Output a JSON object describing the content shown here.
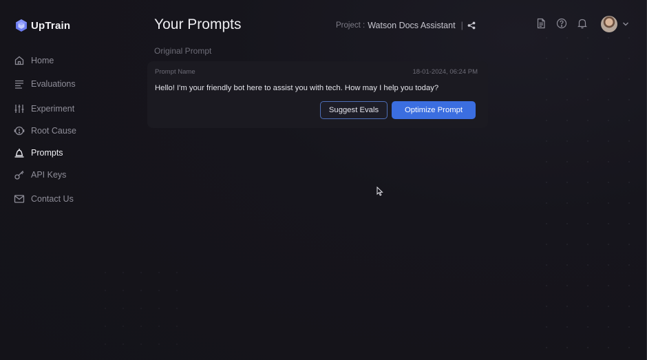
{
  "brand": {
    "name": "UpTrain",
    "accent": "#3b6ee0"
  },
  "sidebar": {
    "items": [
      {
        "label": "Home",
        "icon": "home-icon",
        "active": false
      },
      {
        "label": "Evaluations",
        "icon": "list-icon",
        "active": false
      },
      {
        "label": "Experiment",
        "icon": "sliders-icon",
        "active": false
      },
      {
        "label": "Root Cause",
        "icon": "alert-circle-icon",
        "active": false
      },
      {
        "label": "Prompts",
        "icon": "bell-prompt-icon",
        "active": true
      },
      {
        "label": "API Keys",
        "icon": "key-icon",
        "active": false
      },
      {
        "label": "Contact Us",
        "icon": "mail-icon",
        "active": false
      }
    ]
  },
  "header": {
    "title": "Your Prompts",
    "project_label": "Project :",
    "project_name": "Watson Docs Assistant",
    "separator": "|",
    "icons": [
      "document-icon",
      "help-icon",
      "notification-icon",
      "avatar",
      "chevron-down-icon"
    ]
  },
  "main": {
    "section_label": "Original Prompt",
    "prompt": {
      "name_label": "Prompt Name",
      "date": "18-01-2024, 06:24 PM",
      "text": "Hello! I'm your friendly bot here to assist you with tech. How may I help you today?",
      "suggest_button": "Suggest Evals",
      "optimize_button": "Optimize Prompt"
    }
  }
}
